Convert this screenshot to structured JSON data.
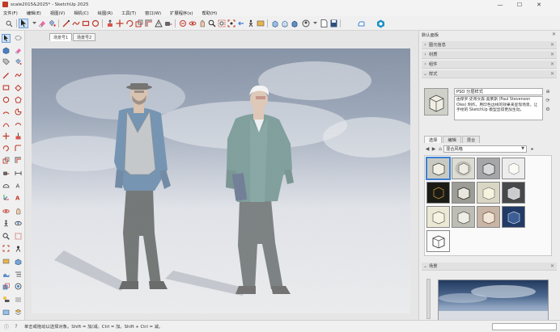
{
  "window": {
    "title": "scale2015&2025* - SketchUp 2025",
    "minimize": "—",
    "maximize": "☐",
    "close": "✕"
  },
  "menu": [
    "文件(F)",
    "编辑(E)",
    "视图(V)",
    "相机(C)",
    "绘图(R)",
    "工具(T)",
    "窗口(W)",
    "扩展程序(x)",
    "帮助(H)"
  ],
  "scene_tabs": [
    "场景号1",
    "场景号2"
  ],
  "tray": {
    "title": "默认面板",
    "sections": [
      "图元信息",
      "材质",
      "组件",
      "样式"
    ],
    "style": {
      "name": "PSO 分层样式",
      "description": "由保罗·史蒂文森·奥莱斯 (Paul Stevenson Oles) 制作，用印色边线的效果来呈现场景，让手绘的 SketchUp 模型显得更加生动。",
      "tabs": [
        "选择",
        "编辑",
        "混合"
      ],
      "library": "混合风格"
    },
    "scenes_section": "场景"
  },
  "status": {
    "hint": "单击或拖动以选择对象。Shift = 加/减。Ctrl = 加。Shift + Ctrl = 减。",
    "measurements_label": ""
  },
  "icons": {
    "select": "arrow-select-icon",
    "eraser": "eraser-icon",
    "paint": "paint-bucket-icon",
    "line": "pencil-line-icon",
    "rectangle": "rectangle-icon",
    "circle": "circle-icon",
    "push_pull": "push-pull-icon",
    "move": "move-icon",
    "rotate": "rotate-icon",
    "scale": "scale-icon",
    "offset": "offset-icon",
    "tape": "tape-measure-icon",
    "text": "text-icon",
    "orbit": "orbit-icon",
    "pan": "pan-icon",
    "zoom": "zoom-icon",
    "zoom_extents": "zoom-extents-icon",
    "walk": "walk-icon",
    "look_around": "look-around-icon",
    "section": "section-plane-icon"
  },
  "colors": {
    "selection": "#3b7fd4",
    "sky_top": "#4a5d7a",
    "ground": "#e3e4e6",
    "jacket": "#3f6f6c"
  }
}
